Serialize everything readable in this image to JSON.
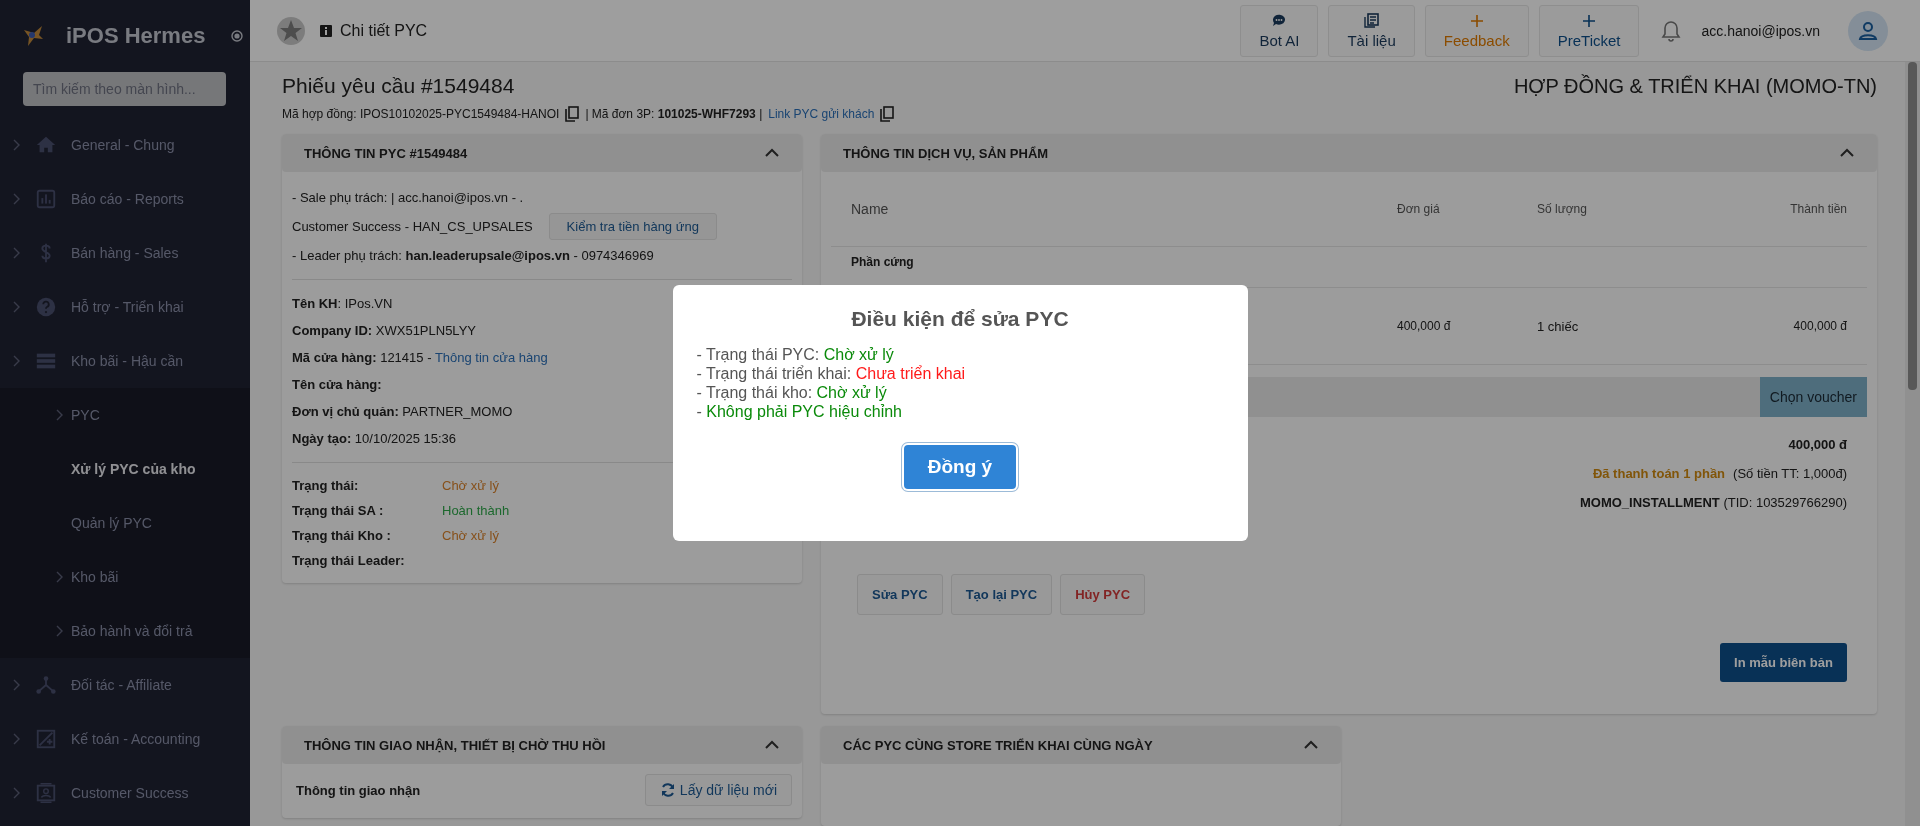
{
  "sidebar": {
    "brand": "iPOS Hermes",
    "search": {
      "placeholder": "Tìm kiếm theo màn hình..."
    },
    "items": [
      {
        "label": "General - Chung",
        "kind": "group",
        "selected": false
      },
      {
        "label": "Báo cáo - Reports",
        "kind": "group",
        "selected": false
      },
      {
        "label": "Bán hàng - Sales",
        "kind": "group",
        "selected": false
      },
      {
        "label": "Hỗ trợ - Triển khai",
        "kind": "group",
        "selected": false
      },
      {
        "label": "Kho bãi - Hậu cần",
        "kind": "group",
        "selected": false,
        "children": [
          {
            "label": "PYC",
            "kind": "group",
            "selected": false
          },
          {
            "label": "Xử lý PYC của kho",
            "kind": "link",
            "selected": true
          },
          {
            "label": "Quản lý PYC",
            "kind": "link",
            "selected": false
          },
          {
            "label": "Kho bãi",
            "kind": "group",
            "selected": false
          },
          {
            "label": "Bảo hành và đổi trả",
            "kind": "group",
            "selected": false
          }
        ]
      },
      {
        "label": "Đối tác - Affiliate",
        "kind": "group",
        "selected": false
      },
      {
        "label": "Kế toán - Accounting",
        "kind": "group",
        "selected": false
      },
      {
        "label": "Customer Success",
        "kind": "group",
        "selected": false
      }
    ]
  },
  "header": {
    "title": "Chi tiết PYC",
    "actions": [
      {
        "label": "Bot AI",
        "kind": "plain"
      },
      {
        "label": "Tài liệu",
        "kind": "plain"
      },
      {
        "label": "Feedback",
        "kind": "feedback"
      },
      {
        "label": "PreTicket",
        "kind": "ticket"
      }
    ],
    "user": "acc.hanoi@ipos.vn"
  },
  "document": {
    "title": "Phiếu yêu cầu #1549484",
    "category": "HỢP ĐỒNG & TRIỂN KHAI (MOMO-TN)",
    "contract": "Mã hợp đồng: IPOS10102025-PYC1549484-HANOI",
    "order": "| Mã đơn 3P: **101025-WHF7293** |",
    "link": "Link PYC gửi khách"
  },
  "info_panel": {
    "title": "THÔNG TIN PYC #1549484",
    "expanded": true,
    "sale": "- Sale phụ trách: | acc.hanoi@ipos.vn - .",
    "cs": "Customer Success - HAN_CS_UPSALES",
    "cs_button": "Kiểm tra tiền hàng ứng",
    "leader": "- Leader phụ trách: **han.leaderupsale@ipos.vn** - 0974346969",
    "fields": [
      {
        "text": "**Tên KH**: IPos.VN"
      },
      {
        "text": "**Company ID:** XWX51PLN5LYY"
      },
      {
        "text": "**Mã cửa hàng:** 121415 -",
        "link": "Thông tin cửa hàng"
      },
      {
        "text": "**Tên cửa hàng:**"
      },
      {
        "text": "**Đơn vị chủ quản:** PARTNER_MOMO"
      },
      {
        "text": "**Ngày tạo:** 10/10/2025 15:36"
      }
    ],
    "statuses": [
      {
        "label": "Trạng thái:",
        "value": "Chờ xử lý",
        "kind": "pending"
      },
      {
        "label": "Trạng thái SA :",
        "value": "Hoàn thành",
        "kind": "done"
      },
      {
        "label": "Trạng thái Kho :",
        "value": "Chờ xử lý",
        "kind": "pending"
      },
      {
        "label": "Trạng thái Leader:"
      }
    ]
  },
  "product_panel": {
    "title": "THÔNG TIN DỊCH VỤ, SẢN PHẨM",
    "expanded": true,
    "columns": [
      "Name",
      "Đơn giá",
      "Số lượng",
      "Thành tiền"
    ],
    "groups": [
      {
        "name": "Phần cứng",
        "rows": [
          {
            "price": "400,000 đ",
            "quantity": "1 chiếc",
            "amount": "400,000 đ"
          }
        ]
      }
    ],
    "voucher_button": "Chọn voucher",
    "total": "400,000 đ",
    "payment_status": "Đã thanh toán 1 phần",
    "payment_amount": "(Số tiền TT: 1,000đ)",
    "payment_method": "**MOMO_INSTALLMENT** (TID: 103529766290)",
    "actions": [
      {
        "label": "Sửa PYC",
        "kind": "normal"
      },
      {
        "label": "Tạo lại PYC",
        "kind": "normal"
      },
      {
        "label": "Hủy PYC",
        "kind": "danger"
      }
    ],
    "print_button": "In mẫu biên bản"
  },
  "bottom_panels": [
    {
      "title": "THÔNG TIN GIAO NHẬN, THIẾT BỊ CHỜ THU HỒI",
      "expanded": true,
      "subtitle": "Thông tin giao nhận",
      "button": "Lấy dữ liệu mới"
    },
    {
      "title": "CÁC PYC CÙNG STORE TRIỂN KHAI CÙNG NGÀY",
      "expanded": true
    }
  ],
  "modal": {
    "title": "Điều kiện để sửa PYC",
    "bullet": "-",
    "conditions": [
      {
        "label": "Trạng thái PYC:",
        "value": "Chờ xử lý",
        "color": "#0a8a0a"
      },
      {
        "label": "Trạng thái triển khai:",
        "value": "Chưa triển khai",
        "color": "#ff1a1a"
      },
      {
        "label": "Trạng thái kho:",
        "value": "Chờ xử lý",
        "color": "#0a8a0a"
      },
      {
        "value": "Không phải PYC hiệu chỉnh",
        "color": "#0a8a0a"
      }
    ],
    "confirm": "Đồng ý"
  }
}
